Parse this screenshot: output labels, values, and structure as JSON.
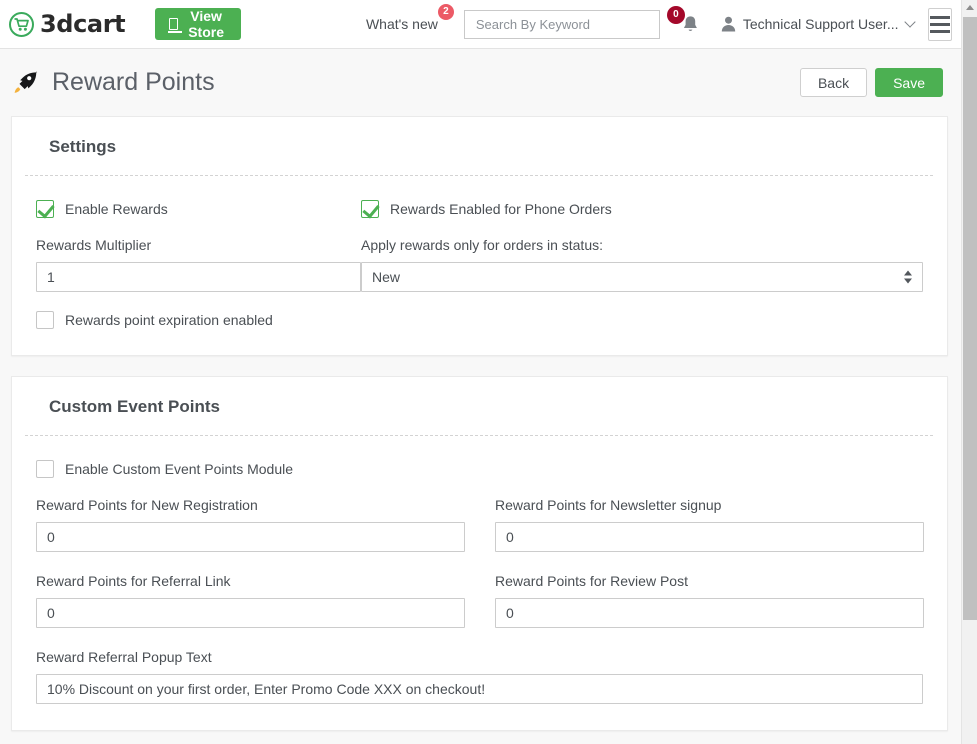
{
  "topbar": {
    "logo_text": "3dcart",
    "logo_icon": "shopping-cart-icon",
    "view_store_label": "View Store",
    "view_store_icon": "monitor-icon",
    "whats_new_label": "What's new",
    "whats_new_count": "2",
    "search_placeholder": "Search By Keyword",
    "search_value": "",
    "search_icon": "search-icon",
    "notification_icon": "bell-icon",
    "notification_count": "0",
    "user_icon": "user-avatar-icon",
    "user_name": "Technical Support User...",
    "chevron_icon": "chevron-down-icon",
    "menu_icon": "hamburger-menu-icon"
  },
  "page": {
    "icon": "rocket-icon",
    "title": "Reward Points",
    "back_label": "Back",
    "save_label": "Save"
  },
  "settings": {
    "title": "Settings",
    "enable_rewards": {
      "label": "Enable Rewards",
      "checked": true
    },
    "phone_orders": {
      "label": "Rewards Enabled for Phone Orders",
      "checked": true
    },
    "multiplier": {
      "label": "Rewards Multiplier",
      "value": "1",
      "placeholder": ""
    },
    "order_status": {
      "label": "Apply rewards only for orders in status:",
      "value": "New"
    },
    "expiration": {
      "label": "Rewards point expiration enabled",
      "checked": false
    }
  },
  "custom_event_points": {
    "title": "Custom Event Points",
    "enable_module": {
      "label": "Enable Custom Event Points Module",
      "checked": false
    },
    "new_registration": {
      "label": "Reward Points for New Registration",
      "value": "0"
    },
    "newsletter_signup": {
      "label": "Reward Points for Newsletter signup",
      "value": "0"
    },
    "referral_link": {
      "label": "Reward Points for Referral Link",
      "value": "0"
    },
    "review_post": {
      "label": "Reward Points for Review Post",
      "value": "0"
    },
    "referral_popup_text": {
      "label": "Reward Referral Popup Text",
      "value": "10% Discount on your first order, Enter Promo Code XXX on checkout!"
    }
  },
  "colors": {
    "brand_green": "#4cb052",
    "badge_red": "#ec5a66",
    "badge_dark_red": "#a4082a",
    "text": "#4a4f54",
    "page_bg": "#f8f8f8"
  }
}
